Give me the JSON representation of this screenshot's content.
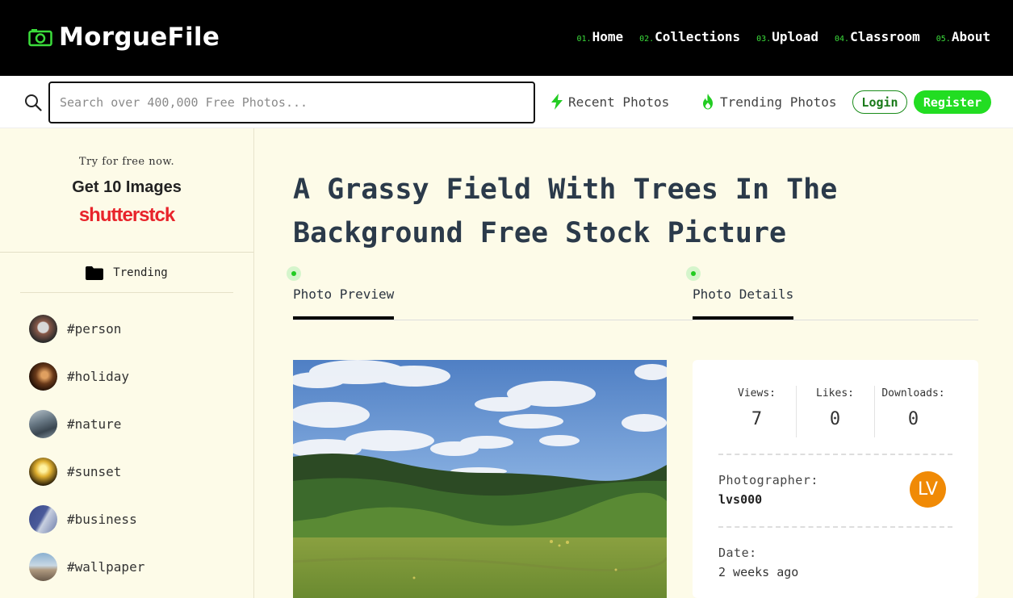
{
  "header": {
    "logo_text": "MorgueFile",
    "nav": [
      {
        "num": "01.",
        "label": "Home"
      },
      {
        "num": "02.",
        "label": "Collections"
      },
      {
        "num": "03.",
        "label": "Upload"
      },
      {
        "num": "04.",
        "label": "Classroom"
      },
      {
        "num": "05.",
        "label": "About"
      }
    ]
  },
  "search": {
    "placeholder": "Search over 400,000 Free Photos...",
    "value": "",
    "recent_label": "Recent Photos",
    "trending_label": "Trending Photos",
    "login_label": "Login",
    "register_label": "Register"
  },
  "sidebar": {
    "promo_try": "Try for free now.",
    "promo_get": "Get 10 Images",
    "promo_brand": "shutterstck",
    "trending_label": "Trending",
    "tags": [
      {
        "label": "#person"
      },
      {
        "label": "#holiday"
      },
      {
        "label": "#nature"
      },
      {
        "label": "#sunset"
      },
      {
        "label": "#business"
      },
      {
        "label": "#wallpaper"
      }
    ]
  },
  "main": {
    "title": "A Grassy Field With Trees In The Background Free Stock Picture",
    "tabs": [
      {
        "label": "Photo Preview"
      },
      {
        "label": "Photo Details"
      }
    ]
  },
  "details": {
    "views_label": "Views:",
    "views_value": "7",
    "likes_label": "Likes:",
    "likes_value": "0",
    "downloads_label": "Downloads:",
    "downloads_value": "0",
    "photographer_label": "Photographer:",
    "photographer_value": "lvs000",
    "avatar_initials": "LV",
    "date_label": "Date:",
    "date_value": "2 weeks ago"
  },
  "colors": {
    "accent_green": "#22dd22",
    "header_bg": "#000000",
    "page_bg": "#fdfbe8",
    "avatar_orange": "#f08a06",
    "brand_red": "#e8242b"
  }
}
